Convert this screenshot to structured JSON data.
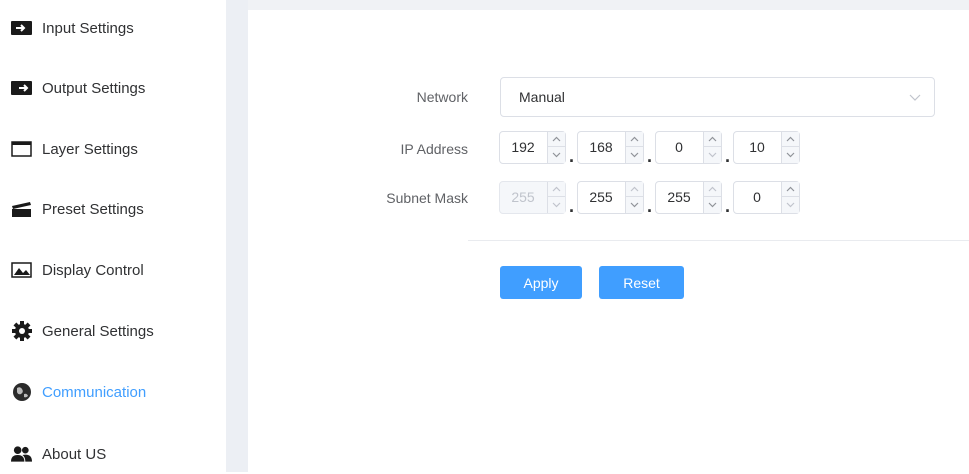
{
  "sidebar": {
    "items": [
      {
        "label": "Input Settings",
        "icon": "input-arrow-icon"
      },
      {
        "label": "Output Settings",
        "icon": "output-arrow-icon"
      },
      {
        "label": "Layer Settings",
        "icon": "window-icon"
      },
      {
        "label": "Preset Settings",
        "icon": "clapperboard-icon"
      },
      {
        "label": "Display Control",
        "icon": "image-icon"
      },
      {
        "label": "General Settings",
        "icon": "gear-icon"
      },
      {
        "label": "Communication",
        "icon": "globe-icon"
      },
      {
        "label": "About US",
        "icon": "users-icon"
      }
    ],
    "active_item": "Communication"
  },
  "form": {
    "network": {
      "label": "Network",
      "value": "Manual"
    },
    "ip_address": {
      "label": "IP Address",
      "octets": [
        "192",
        "168",
        "0",
        "10"
      ]
    },
    "subnet_mask": {
      "label": "Subnet Mask",
      "octets": [
        "255",
        "255",
        "255",
        "0"
      ],
      "first_octet_disabled": true
    },
    "separator": "."
  },
  "buttons": {
    "apply": "Apply",
    "reset": "Reset"
  },
  "colors": {
    "accent": "#409eff",
    "text": "#303133",
    "label": "#606266",
    "border": "#dcdfe6",
    "sidebar_bg": "#eceff4"
  }
}
